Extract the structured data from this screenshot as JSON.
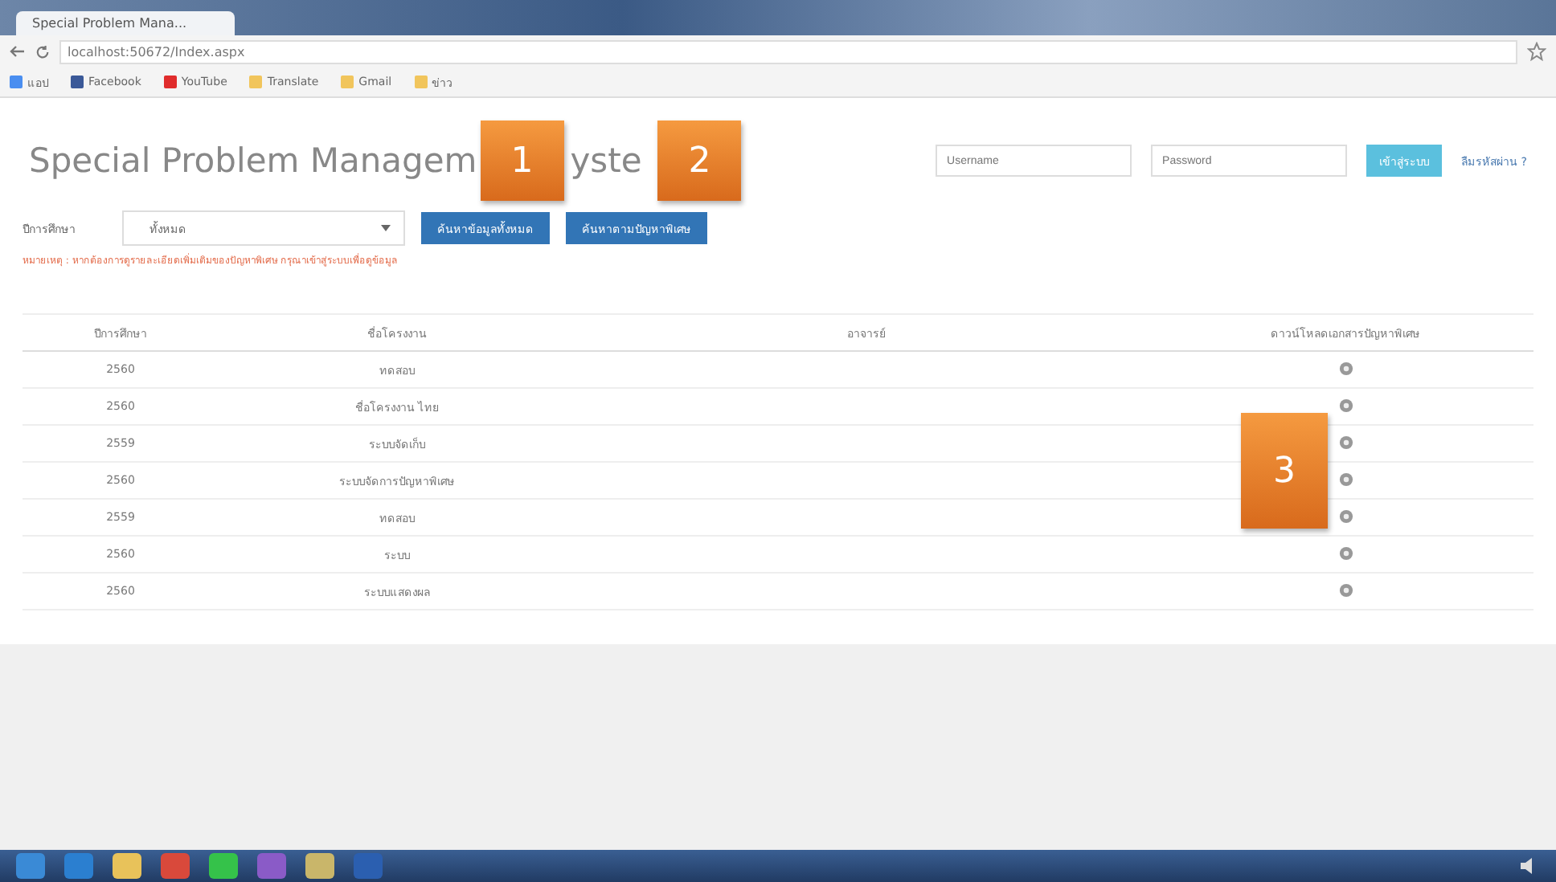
{
  "browser": {
    "tab_title": "Special Problem Mana...",
    "url": "localhost:50672/Index.aspx",
    "bookmarks": [
      {
        "label": "แอป",
        "kind": "apps"
      },
      {
        "label": "Facebook",
        "kind": "facebook"
      },
      {
        "label": "YouTube",
        "kind": "youtube"
      },
      {
        "label": "Translate",
        "kind": "folder"
      },
      {
        "label": "Gmail",
        "kind": "folder"
      },
      {
        "label": "ข่าว",
        "kind": "folder"
      }
    ]
  },
  "header": {
    "title_parts": [
      "Special Problem Managem",
      "yste"
    ],
    "username": {
      "placeholder": "Username"
    },
    "password": {
      "placeholder": "Password"
    },
    "login_button": "เข้าสู่ระบบ",
    "forgot_link": "ลืมรหัสผ่าน ?"
  },
  "filter": {
    "label": "ปีการศึกษา",
    "value": "ทั้งหมด",
    "buttons": [
      "ค้นหาข้อมูลทั้งหมด",
      "ค้นหาตามปัญหาพิเศษ"
    ],
    "note": "หมายเหตุ : หากต้องการดูรายละเอียดเพิ่มเติมของปัญหาพิเศษ กรุณาเข้าสู่ระบบเพื่อดูข้อมูล"
  },
  "callouts": [
    "1",
    "2",
    "3"
  ],
  "table": {
    "columns": [
      "ปีการศึกษา",
      "ชื่อโครงงาน",
      "อาจารย์",
      "ดาวน์โหลดเอกสารปัญหาพิเศษ"
    ],
    "rows": [
      {
        "year": "2560",
        "name": "ทดสอบ"
      },
      {
        "year": "2560",
        "name": "ชื่อโครงงาน ไทย"
      },
      {
        "year": "2559",
        "name": "ระบบจัดเก็บ"
      },
      {
        "year": "2560",
        "name": "ระบบจัดการปัญหาพิเศษ"
      },
      {
        "year": "2559",
        "name": "ทดสอบ"
      },
      {
        "year": "2560",
        "name": "ระบบ"
      },
      {
        "year": "2560",
        "name": "ระบบแสดงผล"
      }
    ]
  },
  "taskbar": {
    "apps": [
      {
        "kind": "start"
      },
      {
        "kind": "ie"
      },
      {
        "kind": "explorer"
      },
      {
        "kind": "chrome"
      },
      {
        "kind": "line"
      },
      {
        "kind": "vs"
      },
      {
        "kind": "tool"
      },
      {
        "kind": "word"
      }
    ]
  }
}
